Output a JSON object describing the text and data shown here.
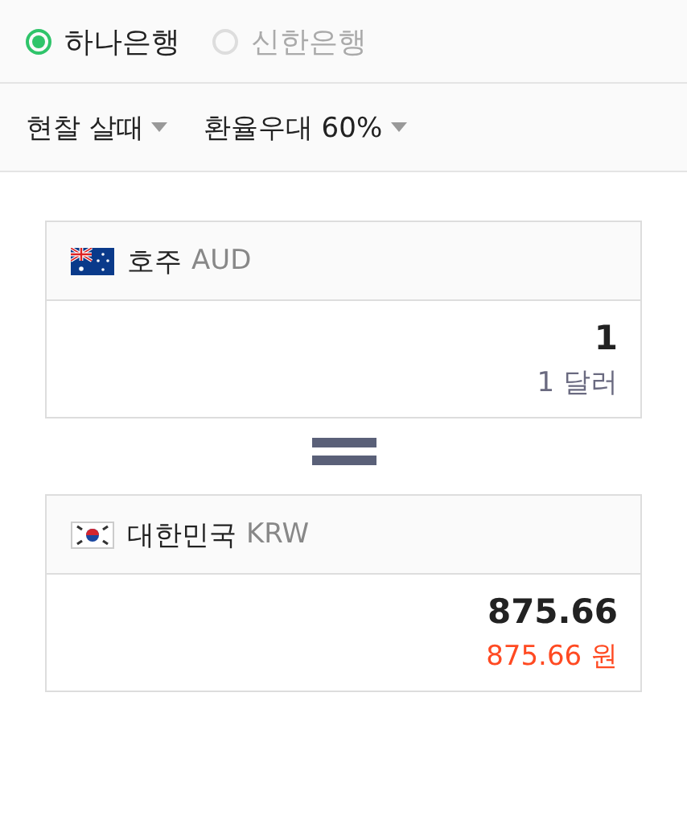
{
  "banks": [
    {
      "label": "하나은행",
      "selected": true
    },
    {
      "label": "신한은행",
      "selected": false
    }
  ],
  "filters": [
    {
      "label": "현찰 살때"
    },
    {
      "label": "환율우대 60%"
    }
  ],
  "currencies": [
    {
      "kind": "australia",
      "name": "호주",
      "code": "AUD",
      "amount": "1",
      "converted": "1 달러",
      "color": "#6a6a80"
    },
    {
      "kind": "korea",
      "name": "대한민국",
      "code": "KRW",
      "amount": "875.66",
      "converted": "875.66 원",
      "color": "#ff4a22"
    }
  ]
}
